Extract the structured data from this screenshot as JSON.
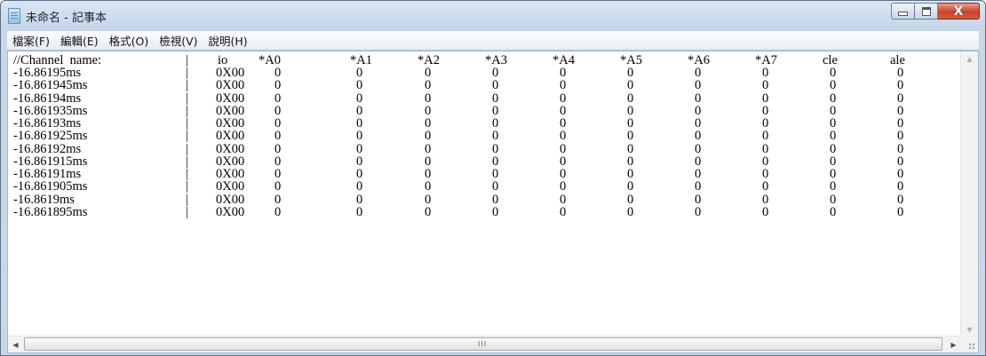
{
  "window": {
    "title": "未命名 - 記事本",
    "close_glyph": "X"
  },
  "menu": [
    "檔案(F)",
    "編輯(E)",
    "格式(O)",
    "檢視(V)",
    "說明(H)"
  ],
  "header": {
    "label": "//Channel  name:",
    "sep": "|",
    "cols": [
      "io",
      "*A0",
      "*A1",
      "*A2",
      "*A3",
      "*A4",
      "*A5",
      "*A6",
      "*A7",
      "cle",
      "ale"
    ]
  },
  "rows": [
    {
      "time": "-16.86195ms",
      "sep": "|",
      "io": "0X00",
      "vals": [
        "0",
        "0",
        "0",
        "0",
        "0",
        "0",
        "0",
        "0",
        "0",
        "0"
      ]
    },
    {
      "time": "-16.861945ms",
      "sep": "|",
      "io": "0X00",
      "vals": [
        "0",
        "0",
        "0",
        "0",
        "0",
        "0",
        "0",
        "0",
        "0",
        "0"
      ]
    },
    {
      "time": "-16.86194ms",
      "sep": "|",
      "io": "0X00",
      "vals": [
        "0",
        "0",
        "0",
        "0",
        "0",
        "0",
        "0",
        "0",
        "0",
        "0"
      ]
    },
    {
      "time": "-16.861935ms",
      "sep": "|",
      "io": "0X00",
      "vals": [
        "0",
        "0",
        "0",
        "0",
        "0",
        "0",
        "0",
        "0",
        "0",
        "0"
      ]
    },
    {
      "time": "-16.86193ms",
      "sep": "|",
      "io": "0X00",
      "vals": [
        "0",
        "0",
        "0",
        "0",
        "0",
        "0",
        "0",
        "0",
        "0",
        "0"
      ]
    },
    {
      "time": "-16.861925ms",
      "sep": "|",
      "io": "0X00",
      "vals": [
        "0",
        "0",
        "0",
        "0",
        "0",
        "0",
        "0",
        "0",
        "0",
        "0"
      ]
    },
    {
      "time": "-16.86192ms",
      "sep": "|",
      "io": "0X00",
      "vals": [
        "0",
        "0",
        "0",
        "0",
        "0",
        "0",
        "0",
        "0",
        "0",
        "0"
      ]
    },
    {
      "time": "-16.861915ms",
      "sep": "|",
      "io": "0X00",
      "vals": [
        "0",
        "0",
        "0",
        "0",
        "0",
        "0",
        "0",
        "0",
        "0",
        "0"
      ]
    },
    {
      "time": "-16.86191ms",
      "sep": "|",
      "io": "0X00",
      "vals": [
        "0",
        "0",
        "0",
        "0",
        "0",
        "0",
        "0",
        "0",
        "0",
        "0"
      ]
    },
    {
      "time": "-16.861905ms",
      "sep": "|",
      "io": "0X00",
      "vals": [
        "0",
        "0",
        "0",
        "0",
        "0",
        "0",
        "0",
        "0",
        "0",
        "0"
      ]
    },
    {
      "time": "-16.8619ms",
      "sep": "|",
      "io": "0X00",
      "vals": [
        "0",
        "0",
        "0",
        "0",
        "0",
        "0",
        "0",
        "0",
        "0",
        "0"
      ]
    },
    {
      "time": "-16.861895ms",
      "sep": "|",
      "io": "0X00",
      "vals": [
        "0",
        "0",
        "0",
        "0",
        "0",
        "0",
        "0",
        "0",
        "0",
        "0"
      ]
    }
  ],
  "scrollbar": {
    "grip": "III"
  }
}
